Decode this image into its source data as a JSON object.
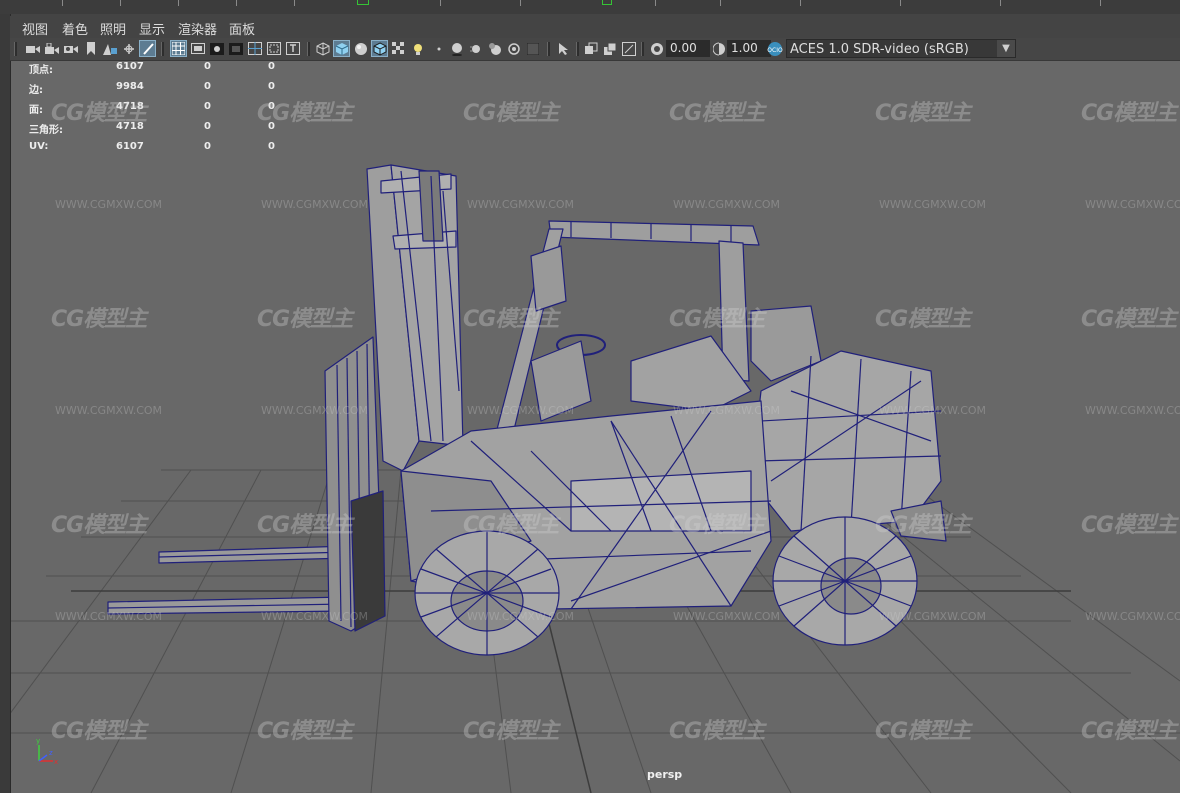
{
  "menubar": {
    "items": [
      "视图",
      "着色",
      "照明",
      "显示",
      "渲染器",
      "面板"
    ]
  },
  "toolbar": {
    "icons": [
      "camera-icon",
      "camera-lock-icon",
      "camera-attr-icon",
      "bookmark-icon",
      "image-plane-icon",
      "two-d-pan-icon",
      "grease-pencil-icon",
      "grid-icon",
      "film-gate-icon",
      "resolution-gate-icon",
      "gate-mask-icon",
      "field-chart-icon",
      "safe-action-icon",
      "wireframe-icon",
      "smooth-shade-icon",
      "wireframe-on-shaded-icon",
      "textured-icon",
      "use-lights-icon",
      "shadows-icon",
      "ambient-occlusion-icon",
      "motion-blur-icon",
      "anti-alias-icon",
      "depth-of-field-icon",
      "isolate-select-icon",
      "xray-icon",
      "xray-active-icon",
      "xray-joints-icon",
      "backface-icon",
      "exposure-icon",
      "gamma-icon",
      "color-management-icon"
    ],
    "exposure": "0.00",
    "gamma": "1.00",
    "color_space": "ACES 1.0 SDR-video (sRGB)"
  },
  "hud": [
    {
      "label": "顶点:",
      "v1": "6107",
      "v2": "0",
      "v3": "0"
    },
    {
      "label": "边:",
      "v1": "9984",
      "v2": "0",
      "v3": "0"
    },
    {
      "label": "面:",
      "v1": "4718",
      "v2": "0",
      "v3": "0"
    },
    {
      "label": "三角形:",
      "v1": "4718",
      "v2": "0",
      "v3": "0"
    },
    {
      "label": "UV:",
      "v1": "6107",
      "v2": "0",
      "v3": "0"
    }
  ],
  "viewport": {
    "camera_label": "persp"
  },
  "watermark": {
    "logo": "CG模型主",
    "url": "WWW.CGMXW.COM"
  },
  "axis": {
    "x": "x",
    "y": "y",
    "z": "z"
  },
  "colors": {
    "viewport_bg": "#686868",
    "wireframe": "#1e1e6e",
    "model": "#9c9c9c"
  }
}
